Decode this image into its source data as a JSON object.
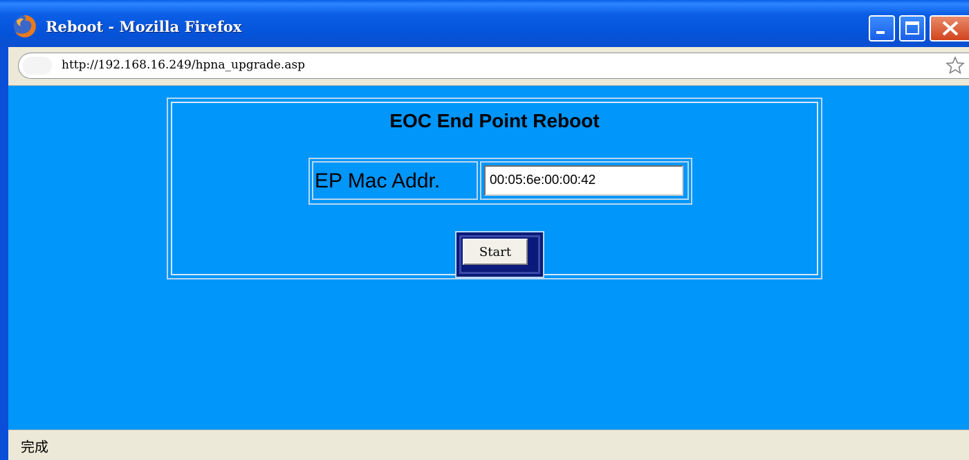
{
  "window": {
    "title": "Reboot - Mozilla Firefox"
  },
  "addressbar": {
    "url": "http://192.168.16.249/hpna_upgrade.asp"
  },
  "page": {
    "heading": "EOC End Point Reboot",
    "mac_label": "EP Mac Addr.",
    "mac_value": "00:05:6e:00:00:42",
    "start_label": "Start"
  },
  "statusbar": {
    "text": "完成"
  },
  "colors": {
    "page_background": "#0096fa",
    "titlebar": "#0553d9",
    "chrome": "#ece9d8",
    "button_frame": "#0a1a7a"
  },
  "icons": {
    "app": "firefox-icon",
    "bookmark": "star-icon",
    "minimize": "minimize-icon",
    "maximize": "maximize-icon",
    "close": "close-icon"
  }
}
